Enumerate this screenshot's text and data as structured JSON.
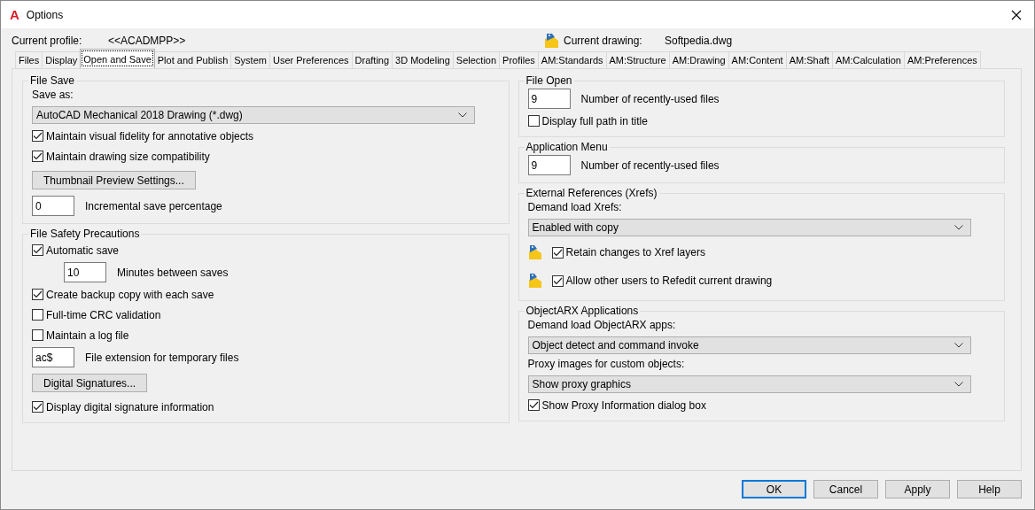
{
  "window": {
    "logo": "A",
    "title": "Options"
  },
  "profile": {
    "label": "Current profile:",
    "value": "<<ACADMPP>>"
  },
  "drawing": {
    "label": "Current drawing:",
    "value": "Softpedia.dwg"
  },
  "tabs": [
    {
      "label": "Files",
      "selected": false
    },
    {
      "label": "Display",
      "selected": false
    },
    {
      "label": "Open and Save",
      "selected": true
    },
    {
      "label": "Plot and Publish",
      "selected": false
    },
    {
      "label": "System",
      "selected": false
    },
    {
      "label": "User Preferences",
      "selected": false
    },
    {
      "label": "Drafting",
      "selected": false
    },
    {
      "label": "3D Modeling",
      "selected": false
    },
    {
      "label": "Selection",
      "selected": false
    },
    {
      "label": "Profiles",
      "selected": false
    },
    {
      "label": "AM:Standards",
      "selected": false
    },
    {
      "label": "AM:Structure",
      "selected": false
    },
    {
      "label": "AM:Drawing",
      "selected": false
    },
    {
      "label": "AM:Content",
      "selected": false
    },
    {
      "label": "AM:Shaft",
      "selected": false
    },
    {
      "label": "AM:Calculation",
      "selected": false
    },
    {
      "label": "AM:Preferences",
      "selected": false
    }
  ],
  "columns": [
    {
      "groups": [
        {
          "title": "File Save",
          "items": [
            {
              "kind": "label",
              "text": "Save as:"
            },
            {
              "kind": "select",
              "value": "AutoCAD Mechanical 2018 Drawing (*.dwg)"
            },
            {
              "kind": "checkbox",
              "text": "Maintain visual fidelity for annotative objects",
              "checked": true
            },
            {
              "kind": "checkbox",
              "text": "Maintain drawing size compatibility",
              "checked": true
            },
            {
              "kind": "button",
              "text": "Thumbnail Preview Settings..."
            },
            {
              "kind": "field",
              "value": "0",
              "text": "Incremental save percentage"
            }
          ]
        },
        {
          "title": "File Safety Precautions",
          "items": [
            {
              "kind": "checkbox",
              "text": "Automatic save",
              "checked": true
            },
            {
              "kind": "subfield",
              "value": "10",
              "text": "Minutes between saves"
            },
            {
              "kind": "checkbox",
              "text": "Create backup copy with each save",
              "checked": true
            },
            {
              "kind": "checkbox",
              "text": "Full-time CRC validation",
              "checked": false
            },
            {
              "kind": "checkbox",
              "text": "Maintain a log file",
              "checked": false
            },
            {
              "kind": "field",
              "value": "ac$",
              "text": "File extension for temporary files"
            },
            {
              "kind": "button",
              "text": "Digital Signatures..."
            },
            {
              "kind": "checkbox",
              "text": "Display digital signature information",
              "checked": true
            }
          ]
        }
      ]
    },
    {
      "groups": [
        {
          "title": "File Open",
          "items": [
            {
              "kind": "field",
              "value": "9",
              "text": "Number of recently-used files"
            },
            {
              "kind": "checkbox",
              "text": "Display full path in title",
              "checked": false
            }
          ]
        },
        {
          "title": "Application Menu",
          "items": [
            {
              "kind": "field",
              "value": "9",
              "text": "Number of recently-used files"
            }
          ]
        },
        {
          "title": "External References (Xrefs)",
          "items": [
            {
              "kind": "label",
              "text": "Demand load Xrefs:"
            },
            {
              "kind": "select",
              "value": "Enabled with copy"
            },
            {
              "kind": "iconcheck",
              "text": "Retain changes to Xref layers",
              "checked": true
            },
            {
              "kind": "iconcheck",
              "text": "Allow other users to Refedit current drawing",
              "checked": true
            }
          ]
        },
        {
          "title": "ObjectARX Applications",
          "items": [
            {
              "kind": "label",
              "text": "Demand load ObjectARX apps:"
            },
            {
              "kind": "select",
              "value": "Object detect and command invoke"
            },
            {
              "kind": "label",
              "text": "Proxy images for custom objects:"
            },
            {
              "kind": "select",
              "value": "Show proxy graphics"
            },
            {
              "kind": "checkbox",
              "text": "Show Proxy Information dialog box",
              "checked": true
            }
          ]
        }
      ]
    }
  ],
  "buttons": [
    {
      "label": "OK",
      "default": true
    },
    {
      "label": "Cancel",
      "default": false
    },
    {
      "label": "Apply",
      "default": false
    },
    {
      "label": "Help",
      "default": false
    }
  ]
}
